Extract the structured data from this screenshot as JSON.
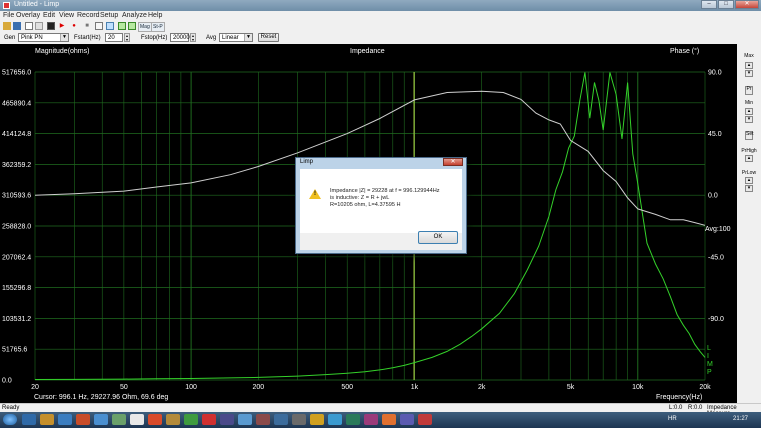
{
  "window": {
    "title": "Untitled - Limp",
    "minimize": "–",
    "maximize": "□",
    "close": "✕"
  },
  "menu": [
    "File",
    "Overlay",
    "Edit",
    "View",
    "Record",
    "Setup",
    "Analyze",
    "Help"
  ],
  "toolbar": {
    "mag": "Mag",
    "stat": "St-P"
  },
  "controls": {
    "gen_label": "Gen",
    "gen_value": "Pink PN",
    "fstart_label": "Fstart(Hz)",
    "fstart_value": "20",
    "fstop_label": "Fstop(Hz)",
    "fstop_value": "20000",
    "avg_label": "Avg",
    "avg_value": "Linear",
    "reset_label": "Reset"
  },
  "sidepanel": {
    "max_label": "Max",
    "pr_label": "Pr",
    "min_label": "Min",
    "set_label": "Set",
    "prhigh_label": "PrHigh",
    "prlow_label": "PrLow"
  },
  "plot": {
    "title": "Impedance",
    "left_axis_label": "Magnitude(ohms)",
    "right_axis_label": "Phase (°)",
    "x_axis_label": "Frequency(Hz)",
    "y_ticks": [
      "517656.0",
      "465890.4",
      "414124.8",
      "362359.2",
      "310593.6",
      "258828.0",
      "207062.4",
      "155296.8",
      "103531.2",
      "51765.6",
      "0.0"
    ],
    "phase_ticks": [
      "90.0",
      "45.0",
      "0.0",
      "-45.0",
      "-90.0"
    ],
    "x_ticks": [
      "20",
      "50",
      "100",
      "200",
      "500",
      "1k",
      "2k",
      "5k",
      "10k",
      "20k"
    ],
    "avg_label": "Avg:100",
    "limp_mark": "LIMP",
    "cursor_text": "Cursor:   996.1 Hz, 29227.96 Ohm, 69.6 deg",
    "colors": {
      "background": "#000000",
      "grid": "#1f6b1f",
      "magnitude": "#34d12a",
      "phase": "#cfcfcf",
      "cursor": "#b7d84a"
    }
  },
  "chart_data": {
    "type": "line",
    "title": "Impedance",
    "xlabel": "Frequency(Hz)",
    "ylabel": "Magnitude(ohms)",
    "y2label": "Phase (°)",
    "xscale": "log",
    "xlim": [
      20,
      20000
    ],
    "ylim": [
      0,
      517656
    ],
    "y2lim": [
      -135,
      90
    ],
    "grid": true,
    "series": [
      {
        "name": "Magnitude",
        "axis": "left",
        "color": "#34d12a",
        "x": [
          20,
          30,
          50,
          70,
          100,
          150,
          200,
          300,
          400,
          500,
          600,
          700,
          800,
          900,
          1000,
          1200,
          1400,
          1600,
          1800,
          2000,
          2400,
          2800,
          3200,
          3600,
          4000,
          4300,
          4600,
          4900,
          5200,
          5500,
          5800,
          6100,
          6400,
          6700,
          7000,
          7500,
          8000,
          8500,
          9000,
          9500,
          10000,
          11000,
          12000,
          13000,
          14000,
          15000,
          16000,
          17000,
          18000,
          19000,
          20000
        ],
        "y": [
          800,
          1000,
          1500,
          2000,
          2600,
          3500,
          4400,
          6500,
          9000,
          11500,
          14000,
          17000,
          20500,
          24500,
          29228,
          38000,
          48000,
          60000,
          73000,
          86000,
          112000,
          145000,
          185000,
          225000,
          275000,
          320000,
          350000,
          390000,
          410000,
          470000,
          517000,
          440000,
          500000,
          470000,
          420000,
          517000,
          480000,
          405000,
          500000,
          380000,
          330000,
          230000,
          195000,
          170000,
          140000,
          110000,
          92000,
          78000,
          60000,
          48000,
          38000
        ]
      },
      {
        "name": "Phase",
        "axis": "right",
        "color": "#cfcfcf",
        "x": [
          20,
          30,
          50,
          70,
          100,
          150,
          200,
          300,
          500,
          700,
          1000,
          1400,
          2000,
          2500,
          3000,
          3500,
          4000,
          4500,
          5000,
          6000,
          7000,
          8000,
          9000,
          10000,
          12000,
          14000,
          16000,
          18000,
          20000
        ],
        "y": [
          0,
          1,
          3,
          6,
          9,
          15,
          21,
          31,
          45,
          56,
          69.6,
          75,
          76,
          75,
          70,
          60,
          55,
          52,
          40,
          32,
          18,
          10,
          -2,
          -10,
          -14,
          -18,
          -18,
          -20,
          -22
        ]
      }
    ]
  },
  "dialog": {
    "title": "Limp",
    "close": "✕",
    "lines": [
      "Impedance |Z| = 29228 at f = 996.129944Hz",
      "is inductive: Z = R + jwL",
      "R=10205 ohm, L=4.37595 H"
    ],
    "ok_label": "OK"
  },
  "status": {
    "left": "Ready",
    "l": "L:0.0",
    "r": "R:0.0",
    "mode": "Impedance Measure"
  },
  "taskbar": {
    "lang": "HR",
    "time": "21:27"
  }
}
